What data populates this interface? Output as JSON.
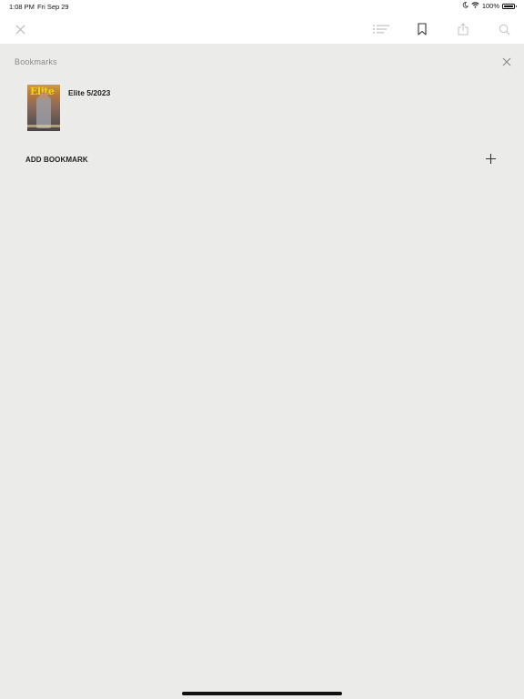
{
  "status_bar": {
    "time": "1:08 PM",
    "date": "Fri Sep 29",
    "battery_percent": "100%",
    "icons": [
      "moon-icon",
      "wifi-icon",
      "battery-icon"
    ]
  },
  "toolbar": {
    "icons": [
      "close-icon",
      "list-icon",
      "bookmark-icon",
      "share-icon",
      "search-icon"
    ]
  },
  "panel": {
    "title": "Bookmarks",
    "close_icon": "close-icon"
  },
  "bookmarks": [
    {
      "label": "Elite 5/2023",
      "cover_text": "Elite"
    }
  ],
  "add_bookmark": {
    "label": "ADD BOOKMARK",
    "icon": "plus-icon"
  },
  "colors": {
    "background": "#ebebea",
    "toolbar": "#ffffff",
    "muted_text": "#8a8a8a",
    "cover_title": "#f2d21a"
  }
}
